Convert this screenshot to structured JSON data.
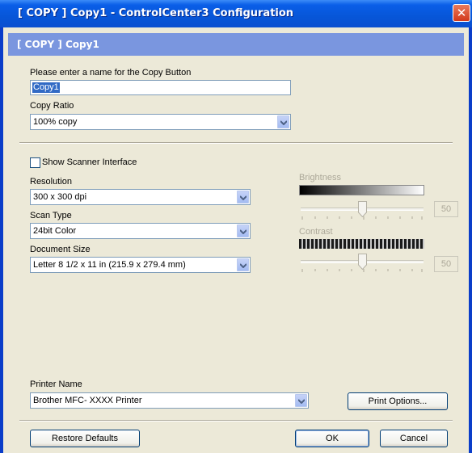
{
  "window": {
    "title": "[ COPY ]  Copy1 - ControlCenter3 Configuration"
  },
  "header": {
    "title": "[ COPY ]  Copy1"
  },
  "name_field": {
    "label": "Please enter a name for the Copy Button",
    "value": "Copy1"
  },
  "copy_ratio": {
    "label": "Copy Ratio",
    "value": "100% copy"
  },
  "scanner": {
    "show_interface_label": "Show Scanner Interface",
    "show_interface_checked": false
  },
  "resolution": {
    "label": "Resolution",
    "value": "300 x 300 dpi"
  },
  "scan_type": {
    "label": "Scan Type",
    "value": "24bit Color"
  },
  "document_size": {
    "label": "Document Size",
    "value": "Letter 8 1/2 x 11 in (215.9 x 279.4 mm)"
  },
  "brightness": {
    "label": "Brightness",
    "value": "50",
    "enabled": false
  },
  "contrast": {
    "label": "Contrast",
    "value": "50",
    "enabled": false
  },
  "printer": {
    "label": "Printer Name",
    "value": "Brother MFC- XXXX  Printer",
    "print_options_label": "Print Options..."
  },
  "footer": {
    "restore_label": "Restore Defaults",
    "ok_label": "OK",
    "cancel_label": "Cancel"
  },
  "colors": {
    "titlebar": "#0a5ee8",
    "header_band": "#7a96df",
    "dialog_bg": "#ece9d8",
    "selection": "#316ac5",
    "disabled_text": "#aca899"
  }
}
